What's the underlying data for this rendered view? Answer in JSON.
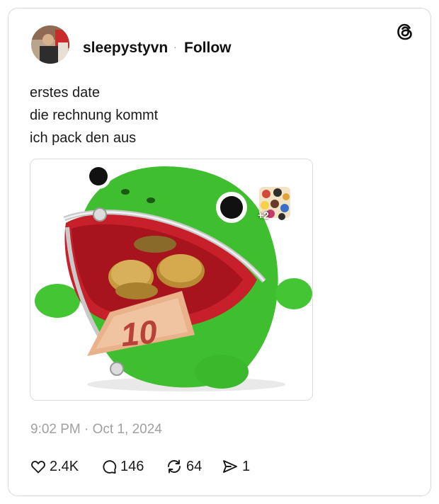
{
  "post": {
    "username": "sleepystyvn",
    "separator": "·",
    "follow_label": "Follow",
    "text_lines": [
      "erstes date",
      "die rechnung kommt",
      "ich pack den aus"
    ],
    "image": {
      "subject": "frog-coin-purse-image",
      "banknote_text": "10",
      "sticker_badge": "+2"
    },
    "timestamp": "9:02 PM · Oct 1, 2024"
  },
  "actions": {
    "likes": "2.4K",
    "replies": "146",
    "reposts": "64",
    "shares": "1"
  },
  "icons": {
    "brand": "threads-logo-icon",
    "like": "heart-icon",
    "reply": "comment-bubble-icon",
    "repost": "repost-icon",
    "share": "send-icon"
  },
  "colors": {
    "text": "#1a1a1a",
    "muted": "#a0a0a0",
    "border": "#d9d9d9",
    "frog_green": "#3fbf2f",
    "mouth_red": "#c8202a"
  }
}
